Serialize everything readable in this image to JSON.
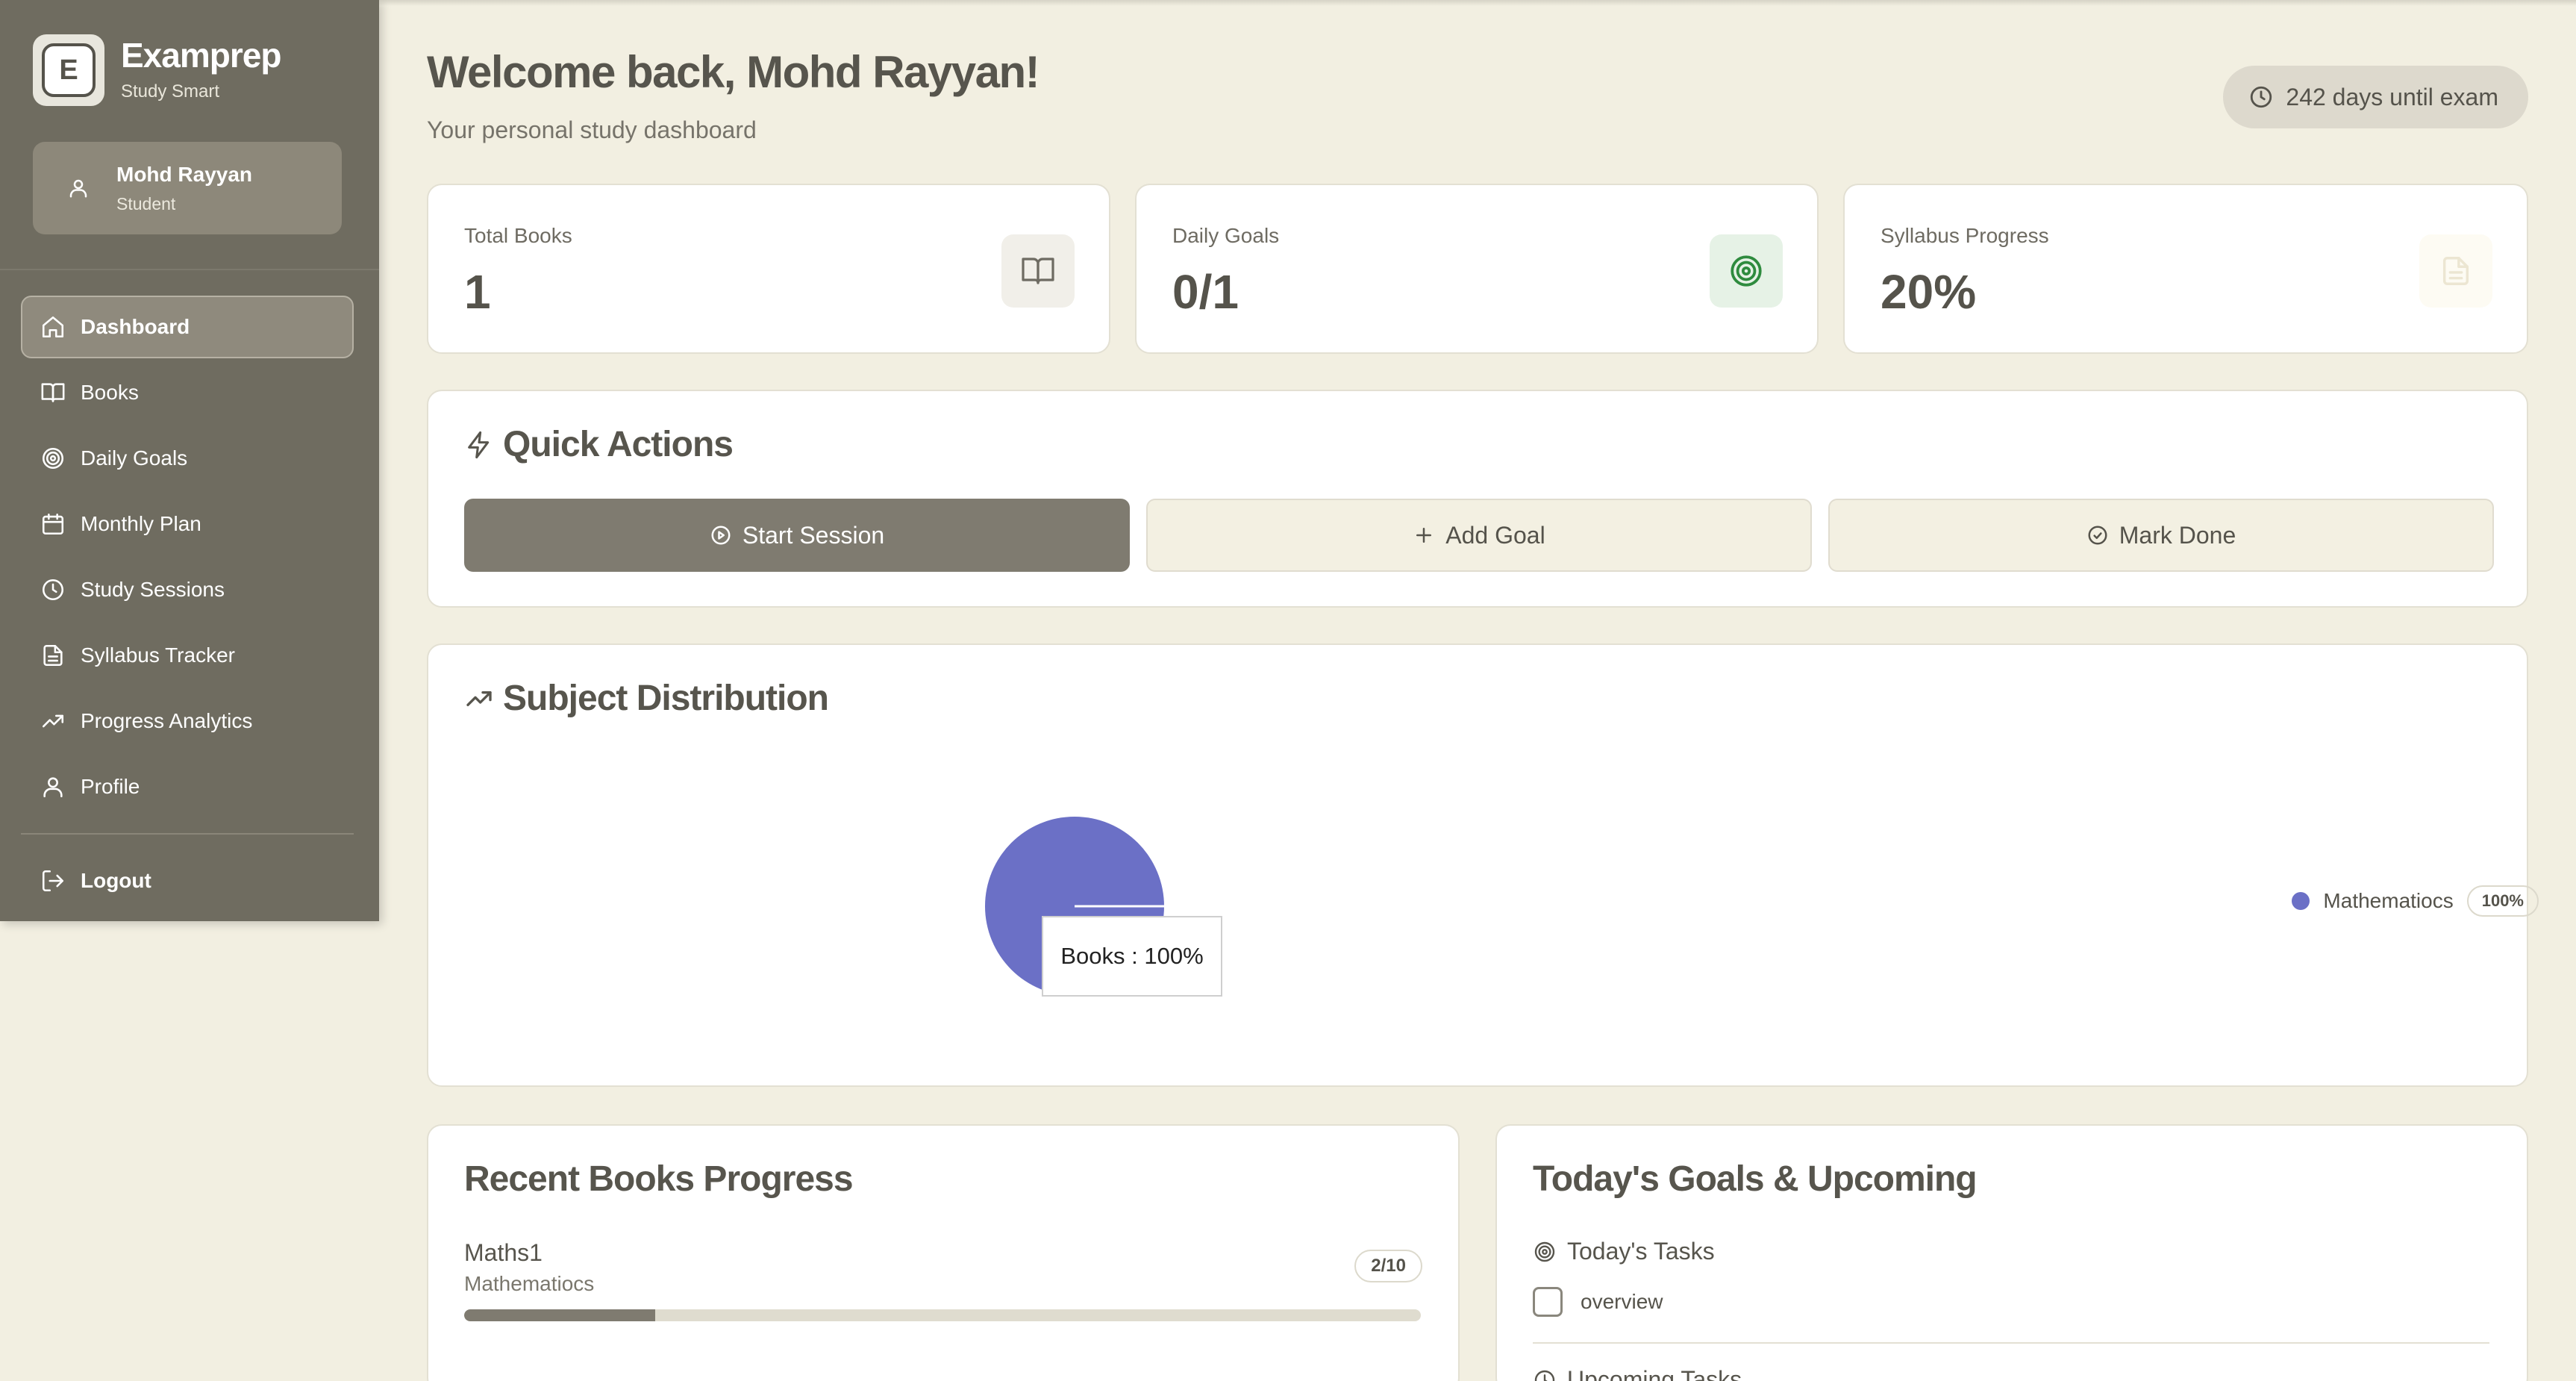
{
  "app": {
    "brand_name": "Examprep",
    "brand_tagline": "Study Smart",
    "logo_letter": "E"
  },
  "user": {
    "name": "Mohd Rayyan",
    "role": "Student"
  },
  "nav": {
    "items": [
      {
        "label": "Dashboard",
        "icon": "home-icon",
        "active": true
      },
      {
        "label": "Books",
        "icon": "book-icon"
      },
      {
        "label": "Daily Goals",
        "icon": "target-icon"
      },
      {
        "label": "Monthly Plan",
        "icon": "calendar-icon"
      },
      {
        "label": "Study Sessions",
        "icon": "clock-icon"
      },
      {
        "label": "Syllabus Tracker",
        "icon": "document-icon"
      },
      {
        "label": "Progress Analytics",
        "icon": "trending-up-icon"
      },
      {
        "label": "Profile",
        "icon": "user-icon"
      }
    ],
    "logout_label": "Logout"
  },
  "header": {
    "title": "Welcome back, Mohd Rayyan!",
    "subtitle": "Your personal study dashboard",
    "exam_countdown": "242 days until exam"
  },
  "stats": [
    {
      "label": "Total Books",
      "value": "1",
      "icon": "book-icon"
    },
    {
      "label": "Daily Goals",
      "value": "0/1",
      "icon": "target-icon"
    },
    {
      "label": "Syllabus Progress",
      "value": "20%",
      "icon": "document-icon"
    }
  ],
  "quick_actions": {
    "title": "Quick Actions",
    "start_session": "Start Session",
    "add_goal": "Add Goal",
    "mark_done": "Mark Done"
  },
  "subject_distribution": {
    "title": "Subject Distribution",
    "tooltip": "Books : 100%",
    "legend": [
      {
        "label": "Mathematiocs",
        "percent": "100%"
      }
    ]
  },
  "chart_data": {
    "type": "pie",
    "categories": [
      "Mathematiocs"
    ],
    "values": [
      100
    ],
    "colors": [
      "#6b70c6"
    ]
  },
  "recent_books": {
    "title": "Recent Books Progress",
    "items": [
      {
        "name": "Maths1",
        "subject": "Mathematiocs",
        "progress_label": "2/10",
        "progress_fraction": 0.2
      }
    ]
  },
  "goals": {
    "title": "Today's Goals & Upcoming",
    "today_heading": "Today's Tasks",
    "tasks": [
      {
        "label": "overview",
        "done": false
      }
    ],
    "upcoming_heading": "Upcoming Tasks"
  },
  "colors": {
    "sidebar": "#6f6c60",
    "background": "#f2efe1",
    "accent": "#7f7b70",
    "chart": "#6b70c6",
    "goal_green": "#2e8b3e"
  }
}
